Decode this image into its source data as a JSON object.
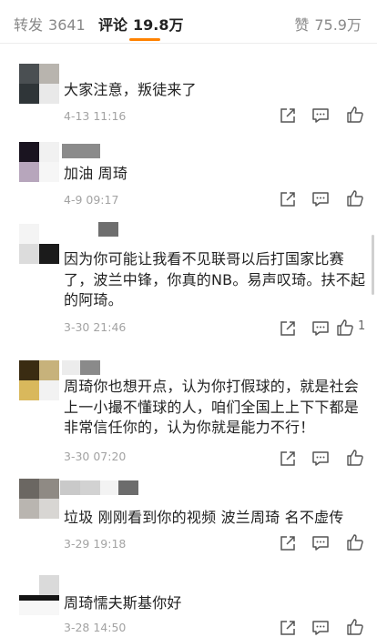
{
  "tabs": {
    "repost": {
      "label": "转发",
      "count": "3641"
    },
    "comment": {
      "label": "评论",
      "count": "19.8万"
    },
    "like": {
      "label": "赞",
      "count": "75.9万"
    }
  },
  "icons": {
    "share": "share-icon",
    "reply": "reply-icon",
    "like": "thumbs-up-icon"
  },
  "colors": {
    "accent": "#ff8200",
    "text": "#222222",
    "secondary": "#a3a3a3"
  },
  "comments": [
    {
      "text": "大家注意，叛徒来了",
      "time": "4-13 11:16",
      "likes": ""
    },
    {
      "text": "加油  周琦",
      "time": "4-9 09:17",
      "likes": ""
    },
    {
      "text": "因为你可能让我看不见联哥以后打国家比赛了，波兰中锋，你真的NB。易声叹琦。扶不起的阿琦。",
      "time": "3-30 21:46",
      "likes": "1"
    },
    {
      "text": "周琦你也想开点，认为你打假球的，就是社会上一小撮不懂球的人，咱们全国上上下下都是非常信任你的，认为你就是能力不行！",
      "time": "3-30 07:20",
      "likes": ""
    },
    {
      "text": "垃圾 刚刚看到你的视频 波兰周琦 名不虚传",
      "time": "3-29 19:18",
      "likes": ""
    },
    {
      "text": "周琦懦夫斯基你好",
      "time": "3-28 14:50",
      "likes": ""
    }
  ]
}
